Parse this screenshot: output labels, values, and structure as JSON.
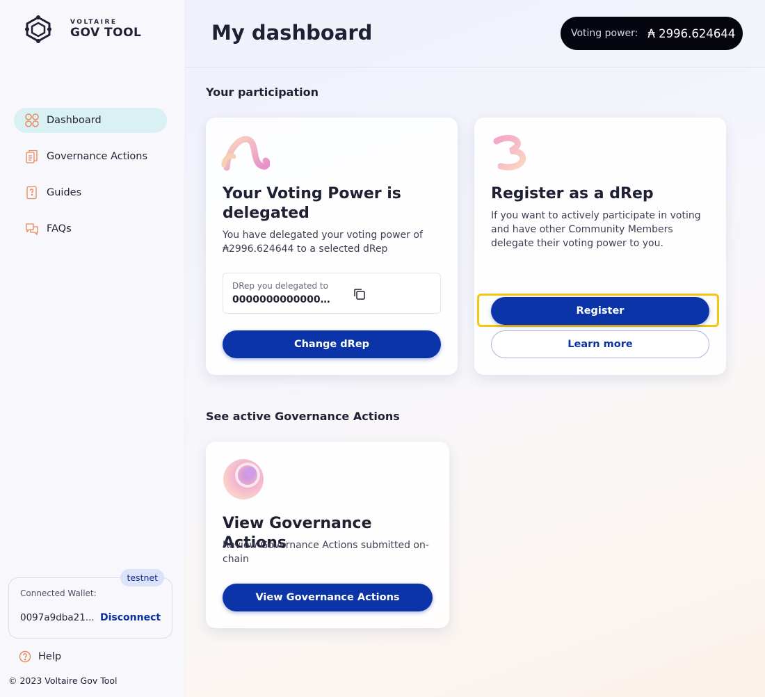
{
  "brand": {
    "small": "VOLTAIRE",
    "big": "GOV TOOL"
  },
  "nav": {
    "items": [
      {
        "label": "Dashboard",
        "icon": "dashboard-icon",
        "active": true
      },
      {
        "label": "Governance Actions",
        "icon": "governance-actions-icon"
      },
      {
        "label": "Guides",
        "icon": "guides-icon"
      },
      {
        "label": "FAQs",
        "icon": "faqs-icon"
      }
    ]
  },
  "wallet": {
    "network": "testnet",
    "label": "Connected Wallet:",
    "address": "0097a9dba21...",
    "disconnect": "Disconnect"
  },
  "help": "Help",
  "copyright": "© 2023 Voltaire Gov Tool",
  "header": {
    "title": "My dashboard",
    "voting_power_label": "Voting power:",
    "voting_power_value": "₳ 2996.624644"
  },
  "sections": {
    "participation": "Your participation",
    "active": "See active Governance Actions"
  },
  "cards": {
    "delegated": {
      "title": "Your Voting Power is delegated",
      "desc": "You have delegated your voting power of ₳2996.624644 to a selected dRep",
      "drep_label": "DRep you delegated to",
      "drep_value": "000000000000000000000000",
      "button": "Change dRep"
    },
    "register": {
      "title": "Register as a dRep",
      "desc": "If you want to actively participate in voting and have other Community Members delegate their voting power to you.",
      "button_primary": "Register",
      "button_secondary": "Learn more"
    },
    "governance": {
      "title": "View Governance Actions",
      "desc": "Review Governance Actions submitted on-chain",
      "button": "View Governance Actions"
    }
  },
  "colors": {
    "primary": "#0b34a8",
    "accent_highlight": "#f2c413",
    "nav_active": "#d9f1f3",
    "icon_orange": "#e9885b"
  }
}
